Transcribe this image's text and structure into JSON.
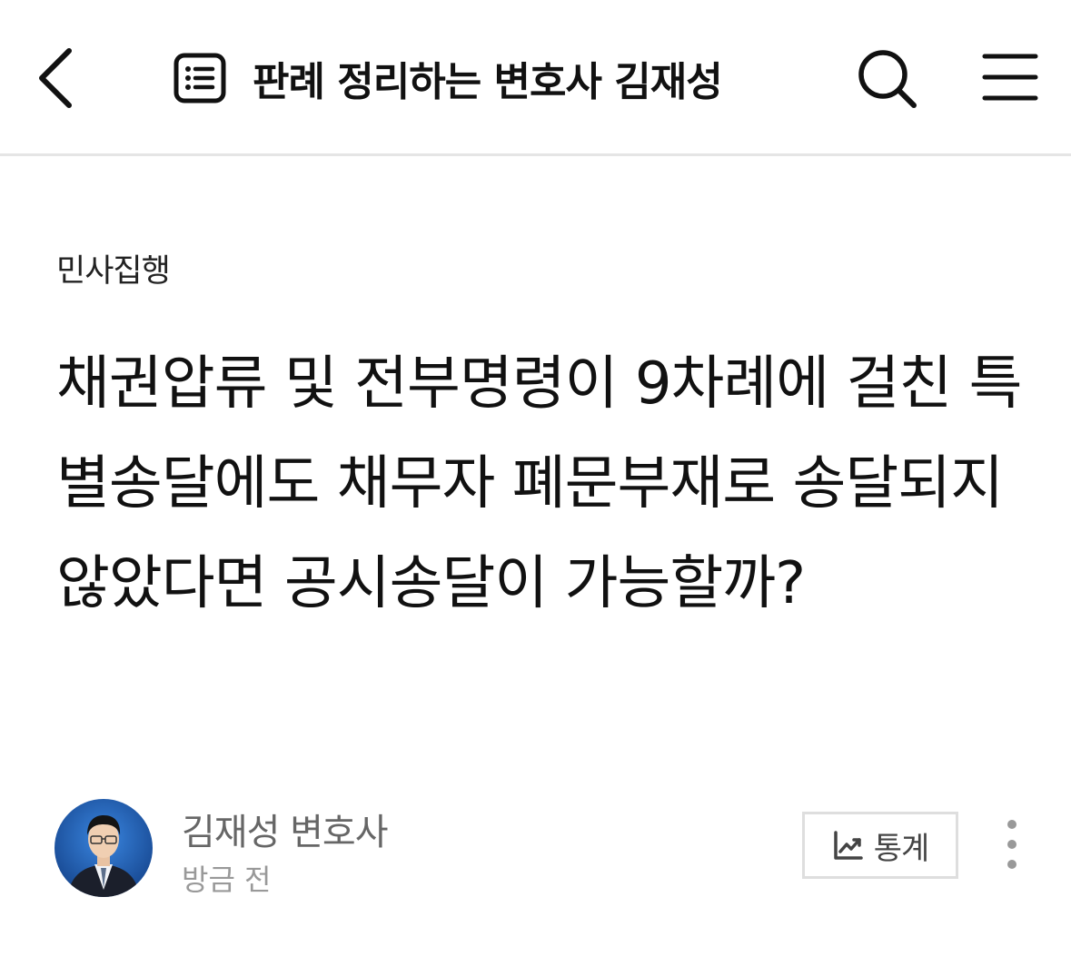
{
  "header": {
    "blog_title": "판례 정리하는 변호사 김재성",
    "icons": {
      "back": "chevron-left-icon",
      "blog": "list-document-icon",
      "search": "search-icon",
      "menu": "hamburger-menu-icon"
    }
  },
  "post": {
    "category": "민사집행",
    "title": "채권압류 및 전부명령이 9차례에 걸친 특별송달에도 채무자 폐문부재로 송달되지 않았다면 공시송달이 가능할까?",
    "author": {
      "name": "김재성 변호사",
      "time": "방금 전"
    },
    "stats_label": "통계",
    "icons": {
      "stats": "trend-chart-icon",
      "more": "more-vertical-icon",
      "avatar": "author-avatar"
    }
  },
  "colors": {
    "title_text": "#111111",
    "author_text": "#666666",
    "time_text": "#999999",
    "divider": "#e5e5e5",
    "stats_border": "#dedede",
    "avatar_bg": "#1c5fb6"
  }
}
